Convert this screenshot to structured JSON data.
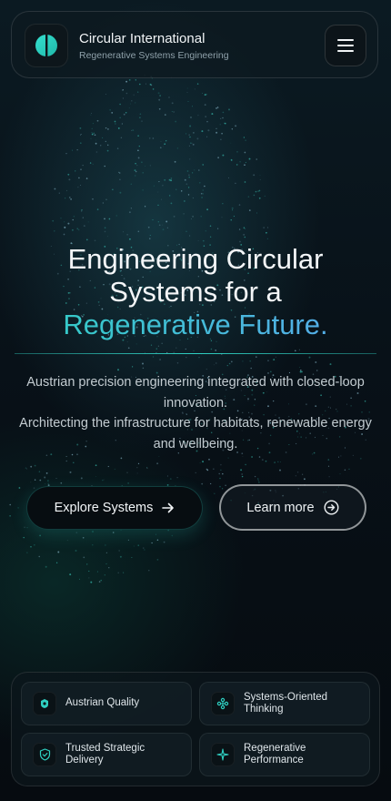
{
  "header": {
    "brand_title": "Circular International",
    "brand_subtitle": "Regenerative Systems Engineering",
    "logo_icon": "half-circle-logo-icon",
    "menu_icon": "hamburger-menu-icon"
  },
  "hero": {
    "title_line1": "Engineering Circular",
    "title_line2": "Systems for a",
    "title_accent": "Regenerative Future.",
    "description_p1": "Austrian precision engineering integrated with closed-loop innovation.",
    "description_p2": "Architecting the infrastructure for habitats, renewable energy and wellbeing."
  },
  "actions": {
    "primary_label": "Explore Systems",
    "primary_icon": "arrow-right-icon",
    "secondary_label": "Learn more",
    "secondary_icon": "circle-arrow-right-icon"
  },
  "features": [
    {
      "label": "Austrian Quality",
      "icon": "badge-icon"
    },
    {
      "label": "Systems-Oriented\nThinking",
      "icon": "network-icon"
    },
    {
      "label": "Trusted Strategic\nDelivery",
      "icon": "shield-check-icon"
    },
    {
      "label": "Regenerative\nPerformance",
      "icon": "sparkle-icon"
    }
  ],
  "colors": {
    "accent_teal": "#2fd0c2",
    "accent_blue": "#5aa7ee",
    "background": "#081118"
  }
}
